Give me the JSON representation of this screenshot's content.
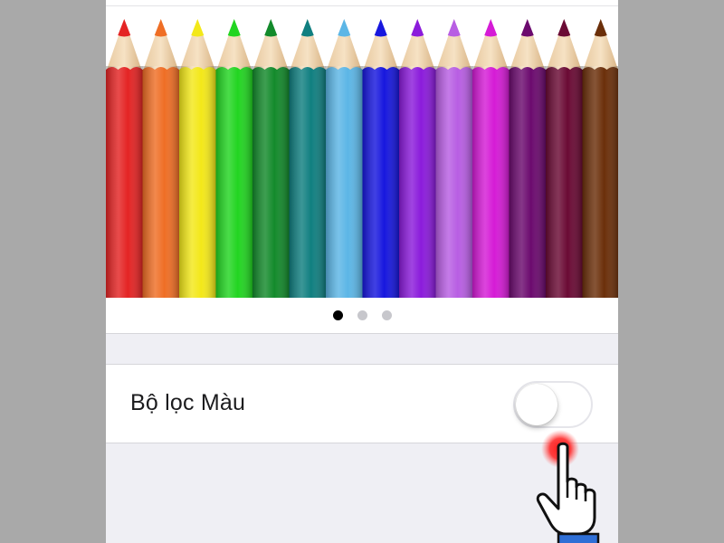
{
  "settings": {
    "color_filters_label": "Bộ lọc Màu",
    "color_filters_enabled": false
  },
  "preview": {
    "page_count": 3,
    "active_page": 1,
    "pencil_colors": [
      "#e42424",
      "#ef6e25",
      "#f3e819",
      "#22d521",
      "#138a2b",
      "#107f80",
      "#5cb6e6",
      "#1717de",
      "#8b1bdb",
      "#b85ee3",
      "#d51bd6",
      "#6b0a6e",
      "#6a0a34",
      "#6b2f0a"
    ]
  },
  "icons": {
    "tap": "tap-indicator-icon",
    "hand": "pointing-hand-icon"
  }
}
